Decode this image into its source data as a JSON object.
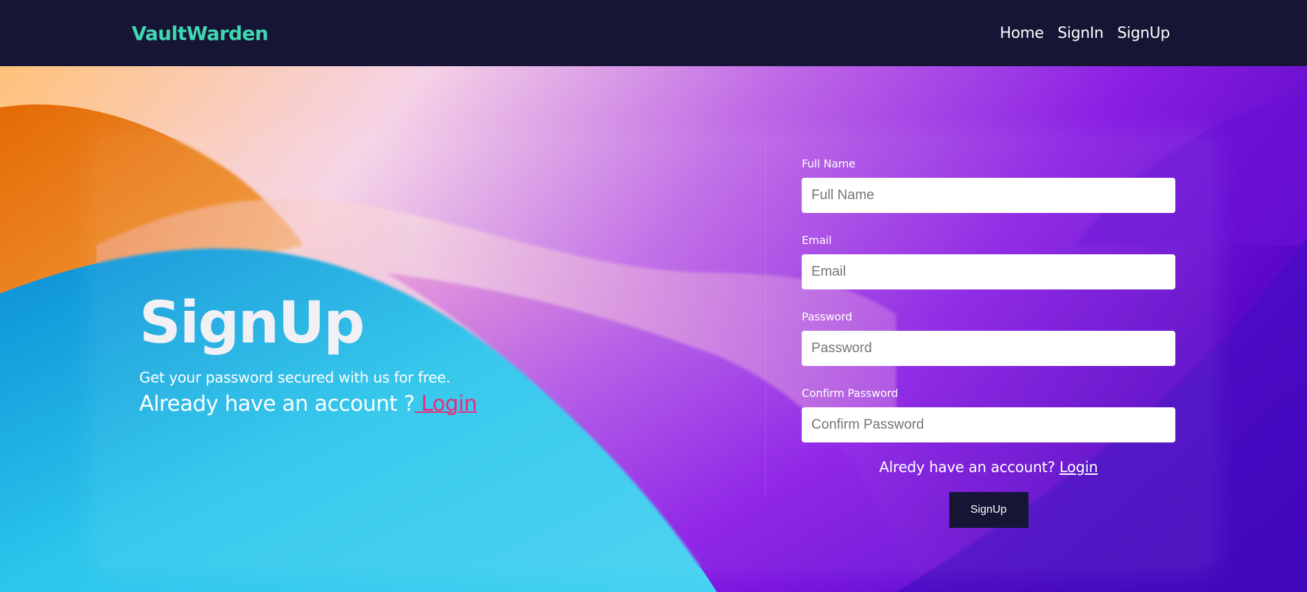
{
  "nav": {
    "brand": "VaultWarden",
    "links": [
      "Home",
      "SignIn",
      "SignUp"
    ]
  },
  "hero": {
    "title": "SignUp",
    "tagline": "Get your password secured with us for free.",
    "already_text": "Already have an account ?",
    "login_link": " Login"
  },
  "form": {
    "fields": [
      {
        "label": "Full Name",
        "placeholder": "Full Name"
      },
      {
        "label": "Email",
        "placeholder": "Email"
      },
      {
        "label": "Password",
        "placeholder": "Password"
      },
      {
        "label": "Confirm Password",
        "placeholder": "Confirm Password"
      }
    ],
    "switch_text": "Alredy have an account?",
    "switch_link": "Login",
    "submit_label": "SignUp"
  },
  "colors": {
    "navbar_bg": "#161536",
    "brand": "#3fd8b1",
    "link_accent": "#ec2a7a",
    "button_bg": "#161536"
  }
}
